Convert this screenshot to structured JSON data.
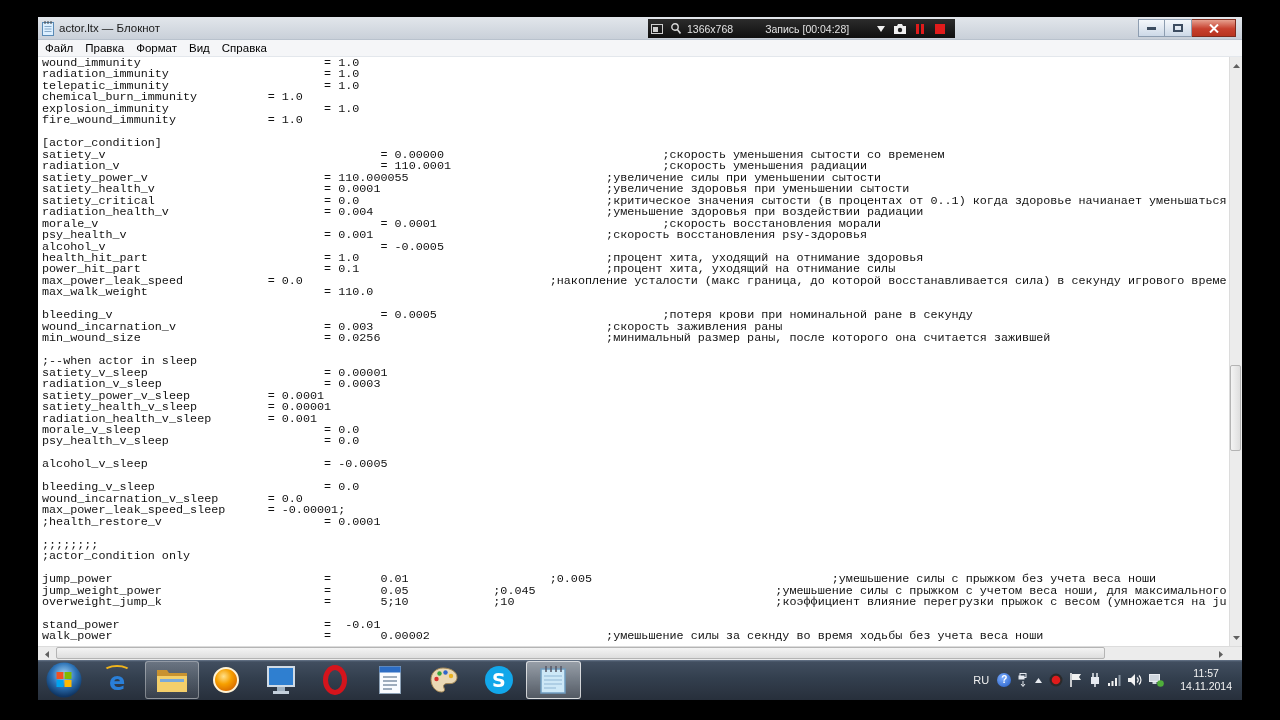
{
  "window": {
    "title": "actor.ltx — Блокнот"
  },
  "recorder": {
    "resolution": "1366x768",
    "status": "Запись [00:04:28]"
  },
  "menu": [
    "Файл",
    "Правка",
    "Формат",
    "Вид",
    "Справка"
  ],
  "editor": {
    "blocks": [
      [
        "wound_immunity\t\t\t\t= 1.0",
        "radiation_immunity\t\t\t= 1.0",
        "telepatic_immunity\t\t\t= 1.0",
        "chemical_burn_immunity\t\t= 1.0",
        "explosion_immunity\t\t\t= 1.0",
        "fire_wound_immunity\t\t= 1.0"
      ],
      [
        "[actor_condition]",
        "satiety_v\t\t\t\t\t= 0.00000\t\t\t\t;скорость уменьшения сытости со временем",
        "radiation_v\t\t\t\t\t= 110.0001\t\t\t\t;скорость уменьшения радиации",
        "satiety_power_v\t\t\t\t= 110.000055\t\t\t\t;увеличение силы при уменьшении сытости",
        "satiety_health_v\t\t\t= 0.0001\t\t\t\t;увеличение здоровья при уменьшении сытости",
        "satiety_critical\t\t\t= 0.0\t\t\t\t\t;критическое значения сытости (в процентах от 0..1) когда здоровье начианает уменьшаться",
        "radiation_health_v\t\t\t= 0.004\t\t\t\t\t;уменьшение здоровья при воздействии радиации",
        "morale_v\t\t\t\t\t= 0.0001\t\t\t\t;скорость восстановления морали",
        "psy_health_v\t\t\t\t= 0.001\t\t\t\t\t;скорость восстановления psy-здоровья",
        "alcohol_v\t\t\t\t\t= -0.0005",
        "health_hit_part\t\t\t\t= 1.0\t\t\t\t\t;процент хита, уходящий на отнимание здоровья",
        "power_hit_part\t\t\t\t= 0.1\t\t\t\t\t;процент хита, уходящий на отнимание силы",
        "max_power_leak_speed\t\t= 0.0\t\t\t\t\t;накопление усталости (макс граница, до которой восстанавливается сила) в секунду игрового време",
        "max_walk_weight\t\t\t\t= 110.0"
      ],
      [
        "bleeding_v\t\t\t\t\t= 0.0005\t\t\t\t;потеря крови при номинальной ране в секунду",
        "wound_incarnation_v\t\t\t= 0.003\t\t\t\t\t;скорость заживления раны",
        "min_wound_size\t\t\t\t= 0.0256\t\t\t\t;минимальный размер раны, после которого она считается зажившей"
      ],
      [
        ";--when actor in sleep",
        "satiety_v_sleep\t\t\t\t= 0.00001",
        "radiation_v_sleep\t\t\t= 0.0003",
        "satiety_power_v_sleep\t\t= 0.0001",
        "satiety_health_v_sleep\t\t= 0.00001",
        "radiation_health_v_sleep\t= 0.001",
        "morale_v_sleep\t\t\t\t= 0.0",
        "psy_health_v_sleep\t\t\t= 0.0"
      ],
      [
        "alcohol_v_sleep\t\t\t\t= -0.0005"
      ],
      [
        "bleeding_v_sleep\t\t\t= 0.0",
        "wound_incarnation_v_sleep\t= 0.0",
        "max_power_leak_speed_sleep\t= -0.00001;",
        ";health_restore_v\t\t\t= 0.0001"
      ],
      [
        ";;;;;;;;",
        ";actor_condition only"
      ],
      [
        "jump_power\t\t\t\t=\t0.01\t\t\t;0.005\t\t\t\t\t;умешьшение силы с прыжком без учета веса ноши",
        "jump_weight_power\t\t\t=\t0.05\t\t;0.045\t\t\t\t\t;умешьшение силы с прыжком с учетом веса ноши, для максимального",
        "overweight_jump_k\t\t\t=\t5;10\t\t;10\t\t\t\t\t;коэффициент влияние перегрузки прыжок с весом (умножается на ju"
      ],
      [
        "stand_power\t\t\t\t=  -0.01",
        "walk_power\t\t\t\t=\t0.00002\t\t\t\t;умешьшение силы за секнду во время ходьбы без учета веса ноши"
      ]
    ]
  },
  "taskbar": {
    "apps": [
      {
        "kind": "browser",
        "glyph": "e",
        "running": false,
        "selected": false
      },
      {
        "kind": "folder",
        "running": true,
        "selected": false
      },
      {
        "kind": "ball",
        "running": false,
        "selected": false
      },
      {
        "kind": "monitor",
        "running": false,
        "selected": false
      },
      {
        "kind": "ring",
        "running": false,
        "selected": false
      },
      {
        "kind": "document",
        "running": false,
        "selected": false
      },
      {
        "kind": "palette",
        "running": false,
        "selected": false
      },
      {
        "kind": "chat",
        "glyph": "S",
        "running": false,
        "selected": false
      },
      {
        "kind": "notepad",
        "running": true,
        "selected": true
      }
    ],
    "tray": {
      "language": "RU",
      "help": "?",
      "time": "11:57",
      "date": "14.11.2014"
    }
  }
}
